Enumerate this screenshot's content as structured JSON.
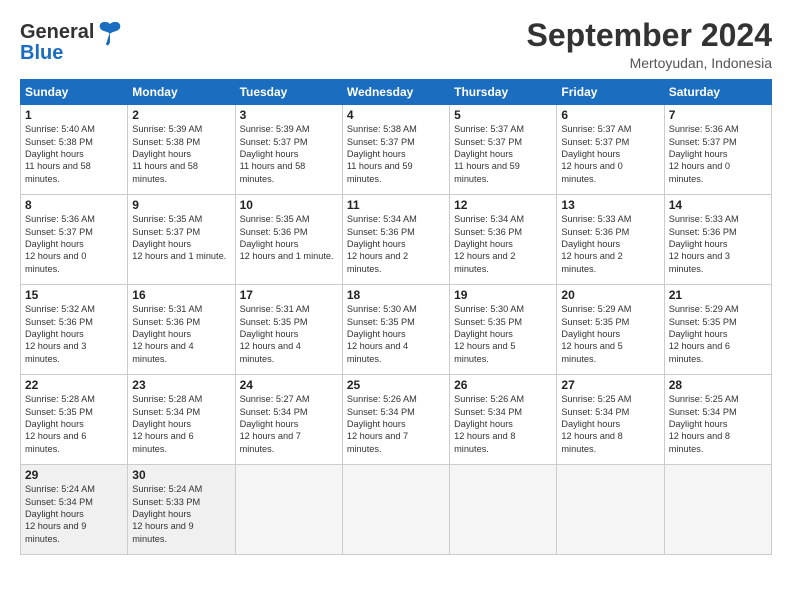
{
  "header": {
    "logo_line1": "General",
    "logo_line2": "Blue",
    "month_title": "September 2024",
    "location": "Mertoyudan, Indonesia"
  },
  "weekdays": [
    "Sunday",
    "Monday",
    "Tuesday",
    "Wednesday",
    "Thursday",
    "Friday",
    "Saturday"
  ],
  "weeks": [
    [
      {
        "day": "1",
        "sunrise": "Sunrise: 5:40 AM",
        "sunset": "Sunset: 5:38 PM",
        "daylight": "Daylight: 11 hours and 58 minutes."
      },
      {
        "day": "2",
        "sunrise": "Sunrise: 5:39 AM",
        "sunset": "Sunset: 5:38 PM",
        "daylight": "Daylight: 11 hours and 58 minutes."
      },
      {
        "day": "3",
        "sunrise": "Sunrise: 5:39 AM",
        "sunset": "Sunset: 5:37 PM",
        "daylight": "Daylight: 11 hours and 58 minutes."
      },
      {
        "day": "4",
        "sunrise": "Sunrise: 5:38 AM",
        "sunset": "Sunset: 5:37 PM",
        "daylight": "Daylight: 11 hours and 59 minutes."
      },
      {
        "day": "5",
        "sunrise": "Sunrise: 5:37 AM",
        "sunset": "Sunset: 5:37 PM",
        "daylight": "Daylight: 11 hours and 59 minutes."
      },
      {
        "day": "6",
        "sunrise": "Sunrise: 5:37 AM",
        "sunset": "Sunset: 5:37 PM",
        "daylight": "Daylight: 12 hours and 0 minutes."
      },
      {
        "day": "7",
        "sunrise": "Sunrise: 5:36 AM",
        "sunset": "Sunset: 5:37 PM",
        "daylight": "Daylight: 12 hours and 0 minutes."
      }
    ],
    [
      {
        "day": "8",
        "sunrise": "Sunrise: 5:36 AM",
        "sunset": "Sunset: 5:37 PM",
        "daylight": "Daylight: 12 hours and 0 minutes."
      },
      {
        "day": "9",
        "sunrise": "Sunrise: 5:35 AM",
        "sunset": "Sunset: 5:37 PM",
        "daylight": "Daylight: 12 hours and 1 minute."
      },
      {
        "day": "10",
        "sunrise": "Sunrise: 5:35 AM",
        "sunset": "Sunset: 5:36 PM",
        "daylight": "Daylight: 12 hours and 1 minute."
      },
      {
        "day": "11",
        "sunrise": "Sunrise: 5:34 AM",
        "sunset": "Sunset: 5:36 PM",
        "daylight": "Daylight: 12 hours and 2 minutes."
      },
      {
        "day": "12",
        "sunrise": "Sunrise: 5:34 AM",
        "sunset": "Sunset: 5:36 PM",
        "daylight": "Daylight: 12 hours and 2 minutes."
      },
      {
        "day": "13",
        "sunrise": "Sunrise: 5:33 AM",
        "sunset": "Sunset: 5:36 PM",
        "daylight": "Daylight: 12 hours and 2 minutes."
      },
      {
        "day": "14",
        "sunrise": "Sunrise: 5:33 AM",
        "sunset": "Sunset: 5:36 PM",
        "daylight": "Daylight: 12 hours and 3 minutes."
      }
    ],
    [
      {
        "day": "15",
        "sunrise": "Sunrise: 5:32 AM",
        "sunset": "Sunset: 5:36 PM",
        "daylight": "Daylight: 12 hours and 3 minutes."
      },
      {
        "day": "16",
        "sunrise": "Sunrise: 5:31 AM",
        "sunset": "Sunset: 5:36 PM",
        "daylight": "Daylight: 12 hours and 4 minutes."
      },
      {
        "day": "17",
        "sunrise": "Sunrise: 5:31 AM",
        "sunset": "Sunset: 5:35 PM",
        "daylight": "Daylight: 12 hours and 4 minutes."
      },
      {
        "day": "18",
        "sunrise": "Sunrise: 5:30 AM",
        "sunset": "Sunset: 5:35 PM",
        "daylight": "Daylight: 12 hours and 4 minutes."
      },
      {
        "day": "19",
        "sunrise": "Sunrise: 5:30 AM",
        "sunset": "Sunset: 5:35 PM",
        "daylight": "Daylight: 12 hours and 5 minutes."
      },
      {
        "day": "20",
        "sunrise": "Sunrise: 5:29 AM",
        "sunset": "Sunset: 5:35 PM",
        "daylight": "Daylight: 12 hours and 5 minutes."
      },
      {
        "day": "21",
        "sunrise": "Sunrise: 5:29 AM",
        "sunset": "Sunset: 5:35 PM",
        "daylight": "Daylight: 12 hours and 6 minutes."
      }
    ],
    [
      {
        "day": "22",
        "sunrise": "Sunrise: 5:28 AM",
        "sunset": "Sunset: 5:35 PM",
        "daylight": "Daylight: 12 hours and 6 minutes."
      },
      {
        "day": "23",
        "sunrise": "Sunrise: 5:28 AM",
        "sunset": "Sunset: 5:34 PM",
        "daylight": "Daylight: 12 hours and 6 minutes."
      },
      {
        "day": "24",
        "sunrise": "Sunrise: 5:27 AM",
        "sunset": "Sunset: 5:34 PM",
        "daylight": "Daylight: 12 hours and 7 minutes."
      },
      {
        "day": "25",
        "sunrise": "Sunrise: 5:26 AM",
        "sunset": "Sunset: 5:34 PM",
        "daylight": "Daylight: 12 hours and 7 minutes."
      },
      {
        "day": "26",
        "sunrise": "Sunrise: 5:26 AM",
        "sunset": "Sunset: 5:34 PM",
        "daylight": "Daylight: 12 hours and 8 minutes."
      },
      {
        "day": "27",
        "sunrise": "Sunrise: 5:25 AM",
        "sunset": "Sunset: 5:34 PM",
        "daylight": "Daylight: 12 hours and 8 minutes."
      },
      {
        "day": "28",
        "sunrise": "Sunrise: 5:25 AM",
        "sunset": "Sunset: 5:34 PM",
        "daylight": "Daylight: 12 hours and 8 minutes."
      }
    ],
    [
      {
        "day": "29",
        "sunrise": "Sunrise: 5:24 AM",
        "sunset": "Sunset: 5:34 PM",
        "daylight": "Daylight: 12 hours and 9 minutes."
      },
      {
        "day": "30",
        "sunrise": "Sunrise: 5:24 AM",
        "sunset": "Sunset: 5:33 PM",
        "daylight": "Daylight: 12 hours and 9 minutes."
      },
      null,
      null,
      null,
      null,
      null
    ]
  ]
}
